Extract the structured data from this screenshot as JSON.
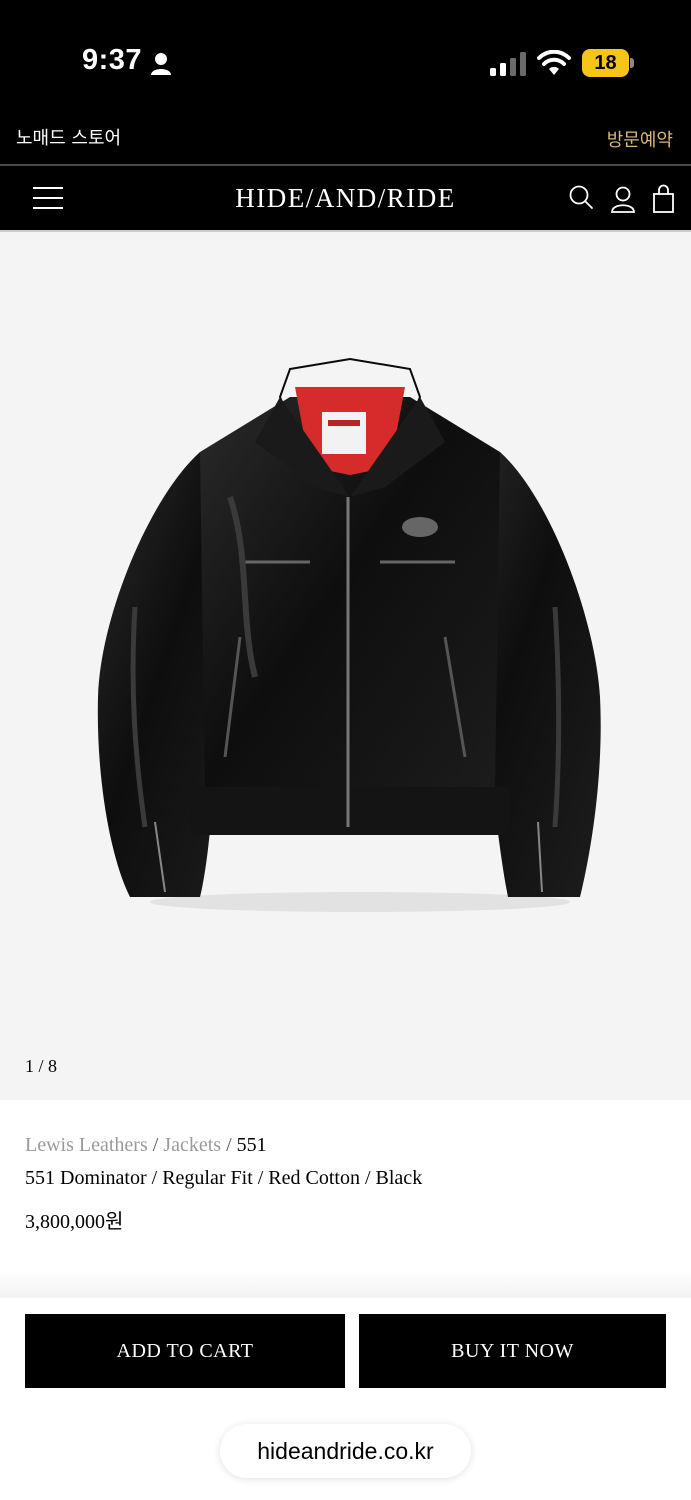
{
  "status_bar": {
    "time": "9:37",
    "battery_level": "18",
    "battery_color": "#f5c518",
    "icons": [
      "person-icon",
      "cellular-signal-icon",
      "wifi-icon",
      "battery-icon"
    ]
  },
  "store_bar": {
    "store_name": "노매드 스토어",
    "visit_link": "방문예약",
    "visit_link_color": "#d9b77e"
  },
  "header": {
    "brand": "HIDE/AND/RIDE",
    "icons": [
      "menu-icon",
      "search-icon",
      "account-icon",
      "shopping-bag-icon"
    ]
  },
  "gallery": {
    "image": "black-leather-jacket-photo",
    "counter": "1 / 8"
  },
  "product": {
    "breadcrumb": {
      "brand": "Lewis Leathers",
      "sep1": "/",
      "category": "Jackets",
      "sep2": "/",
      "model": "551"
    },
    "title": "551 Dominator / Regular Fit / Red Cotton / Black",
    "price": "3,800,000원"
  },
  "actions": {
    "add_to_cart": "ADD TO CART",
    "buy_now": "BUY IT NOW"
  },
  "browser": {
    "url": "hideandride.co.kr"
  }
}
